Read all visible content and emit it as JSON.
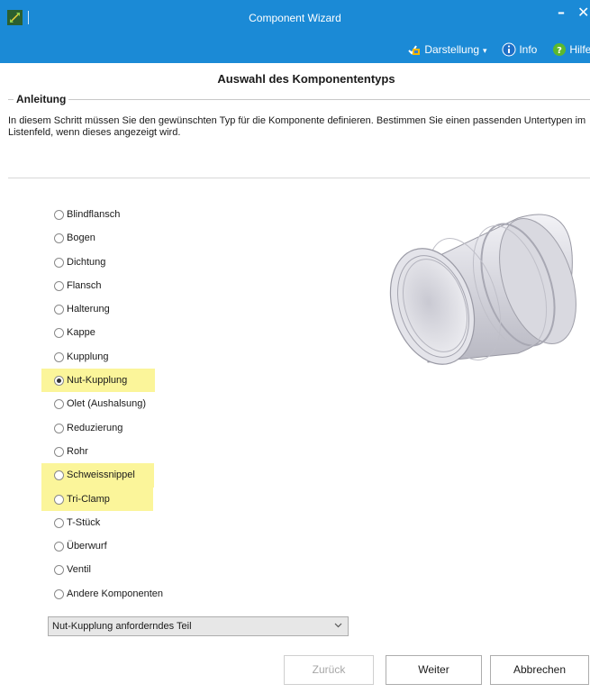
{
  "window": {
    "title": "Component Wizard",
    "minimize_glyph": "–",
    "close_glyph": "✕"
  },
  "menubar": {
    "view_label": "Darstellung",
    "info_label": "Info",
    "help_label": "Hilfe"
  },
  "page": {
    "heading": "Auswahl des Komponententyps"
  },
  "instructions": {
    "legend": "Anleitung",
    "text": "In diesem Schritt müssen Sie den gewünschten Typ für die Komponente definieren. Bestimmen Sie einen passenden Untertypen im Listenfeld, wenn dieses angezeigt wird."
  },
  "component_types": [
    {
      "label": "Blindflansch",
      "selected": false,
      "highlighted": false
    },
    {
      "label": "Bogen",
      "selected": false,
      "highlighted": false
    },
    {
      "label": "Dichtung",
      "selected": false,
      "highlighted": false
    },
    {
      "label": "Flansch",
      "selected": false,
      "highlighted": false
    },
    {
      "label": "Halterung",
      "selected": false,
      "highlighted": false
    },
    {
      "label": "Kappe",
      "selected": false,
      "highlighted": false
    },
    {
      "label": "Kupplung",
      "selected": false,
      "highlighted": false
    },
    {
      "label": "Nut-Kupplung",
      "selected": true,
      "highlighted": true
    },
    {
      "label": "Olet (Aushalsung)",
      "selected": false,
      "highlighted": false
    },
    {
      "label": "Reduzierung",
      "selected": false,
      "highlighted": false
    },
    {
      "label": "Rohr",
      "selected": false,
      "highlighted": false
    },
    {
      "label": "Schweissnippel",
      "selected": false,
      "highlighted": true
    },
    {
      "label": "Tri-Clamp",
      "selected": false,
      "highlighted": true
    },
    {
      "label": "T-Stück",
      "selected": false,
      "highlighted": false
    },
    {
      "label": "Überwurf",
      "selected": false,
      "highlighted": false
    },
    {
      "label": "Ventil",
      "selected": false,
      "highlighted": false
    },
    {
      "label": "Andere Komponenten",
      "selected": false,
      "highlighted": false
    }
  ],
  "subtype_dropdown": {
    "value": "Nut-Kupplung anforderndes Teil"
  },
  "buttons": {
    "back": "Zurück",
    "next": "Weiter",
    "cancel": "Abbrechen"
  },
  "colors": {
    "titlebar": "#1b8ad6",
    "highlight": "#fbf59a"
  },
  "icons": {
    "app": "wizard-app-icon",
    "view": "view-icon",
    "info": "info-icon",
    "help": "help-icon"
  }
}
